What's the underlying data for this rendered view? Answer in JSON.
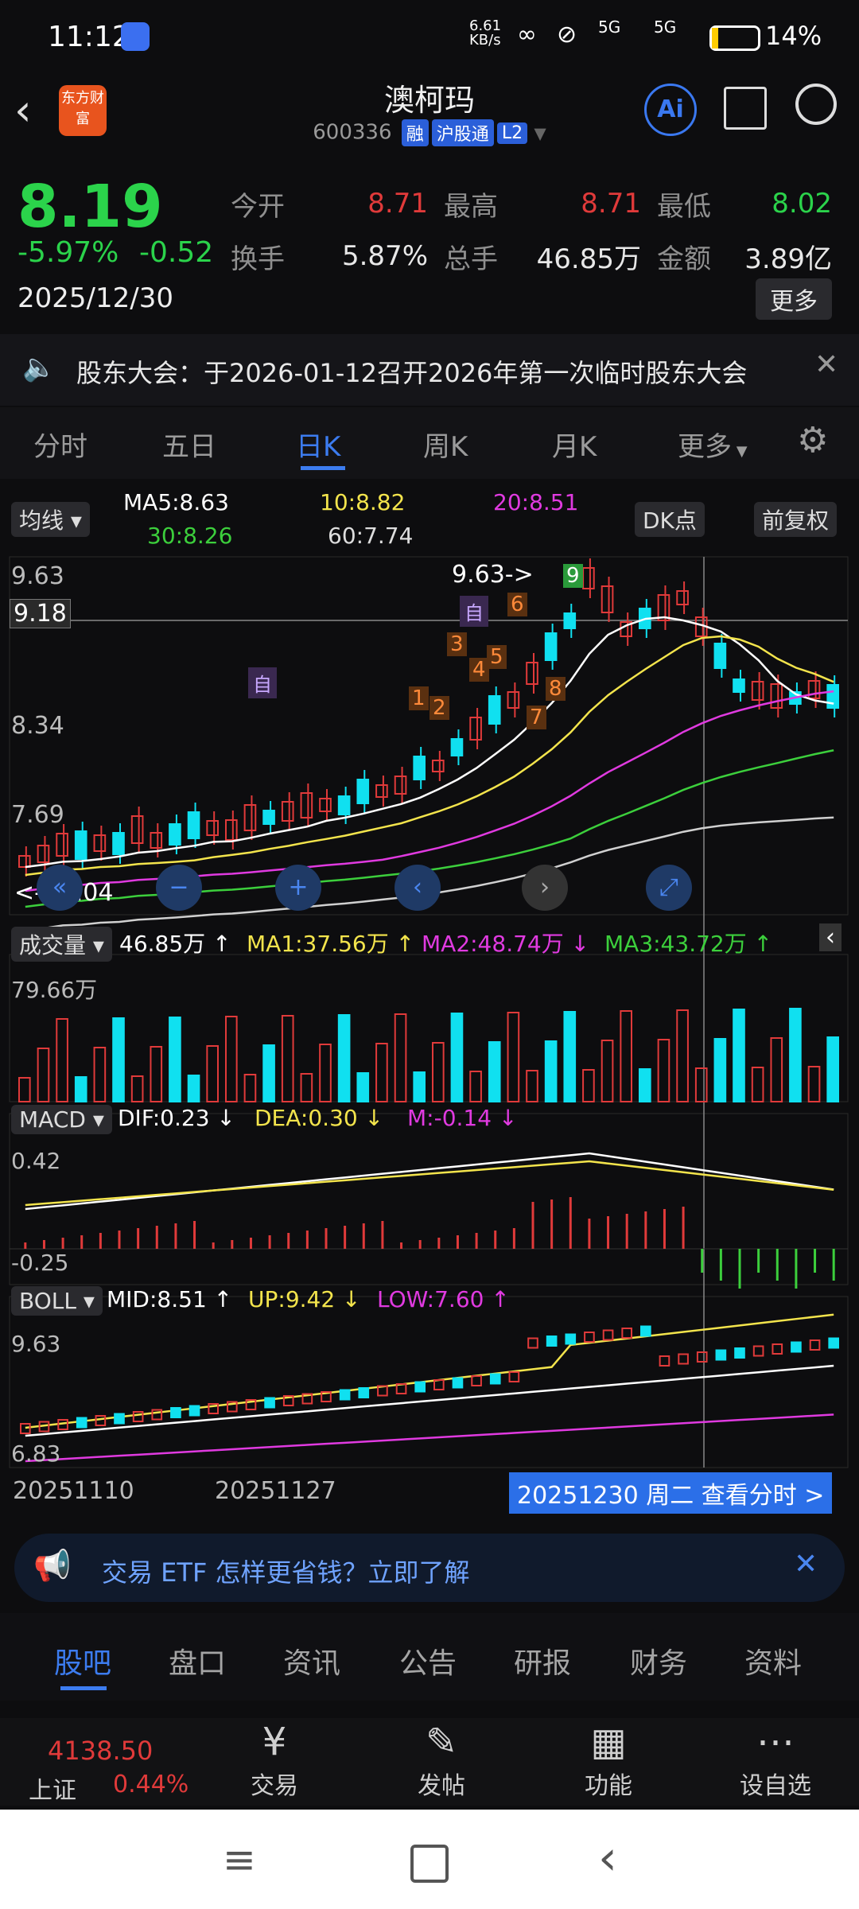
{
  "status": {
    "time": "11:12",
    "speed": "6.61",
    "speed_unit": "KB/s",
    "network1": "5G",
    "network2": "5G",
    "battery": "14",
    "battery_pct_sign": "%"
  },
  "header": {
    "title": "澳柯玛",
    "code": "600336",
    "tag_margin": "融",
    "tag_hk": "沪股通",
    "tag_level": "L2",
    "logo_text": "东方财富",
    "ai_label": "Ai"
  },
  "quote": {
    "price": "8.19",
    "pct": "-5.97%",
    "chg": "-0.52",
    "date": "2025/12/30",
    "open_label": "今开",
    "open": "8.71",
    "high_label": "最高",
    "high": "8.71",
    "low_label": "最低",
    "low": "8.02",
    "turnover_label": "换手",
    "turnover": "5.87%",
    "vol_label": "总手",
    "vol": "46.85万",
    "amount_label": "金额",
    "amount": "3.89亿",
    "more": "更多"
  },
  "notice": {
    "text": "股东大会：于2026-01-12召开2026年第一次临时股东大会"
  },
  "tabs": [
    "分时",
    "五日",
    "日K",
    "周K",
    "月K",
    "更多",
    ""
  ],
  "active_tab": 2,
  "chart": {
    "ma_selector": "均线",
    "ma5": "MA5:8.63",
    "ma10": "10:8.82",
    "ma20": "20:8.51",
    "ma30": "30:8.26",
    "ma60": "60:7.74",
    "dk_label": "DK点",
    "adjust_label": "前复权",
    "y_top": "9.63",
    "y_cross": "9.18",
    "y_mid": "8.34",
    "y_low": "7.69",
    "high_mark": "9.63->",
    "low_mark": "<---7.04",
    "badge_self1": "自",
    "badge_self2": "自",
    "seq": [
      "1",
      "2",
      "3",
      "4",
      "5",
      "6",
      "7",
      "8",
      "9"
    ],
    "vol_selector": "成交量",
    "vol_val": "46.85万",
    "vol_ma1": "MA1:37.56万",
    "vol_ma2": "MA2:48.74万",
    "vol_ma3": "MA3:43.72万",
    "vol_scale": "79.66万",
    "macd_selector": "MACD",
    "dif": "DIF:0.23",
    "dea": "DEA:0.30",
    "m": "M:-0.14",
    "macd_top": "0.42",
    "macd_bot": "-0.25",
    "boll_selector": "BOLL",
    "mid": "MID:8.51",
    "up": "UP:9.42",
    "low": "LOW:7.60",
    "boll_top": "9.63",
    "boll_bot": "6.83",
    "date_start": "20251110",
    "date_mid": "20251127",
    "cursor_info": "20251230 周二 查看分时 >"
  },
  "colors": {
    "up": "#e03a3a",
    "down": "#10e0f0",
    "ma5": "#ffffff",
    "ma10": "#f3e44c",
    "ma20": "#e03ae0",
    "ma30": "#3ccf3c",
    "ma60": "#d0d0d0",
    "accent": "#2b6fe8"
  },
  "ad": {
    "text": "交易 ETF 怎样更省钱？立即了解"
  },
  "bottom_tabs": [
    "股吧",
    "盘口",
    "资讯",
    "公告",
    "研报",
    "财务",
    "资料"
  ],
  "index": {
    "value": "4138.50",
    "name": "上证",
    "pct": "0.44%"
  },
  "toolbar": [
    {
      "label": "交易",
      "icon": "trade-icon"
    },
    {
      "label": "发帖",
      "icon": "post-icon"
    },
    {
      "label": "功能",
      "icon": "grid-icon"
    },
    {
      "label": "设自选",
      "icon": "more-icon"
    }
  ]
}
